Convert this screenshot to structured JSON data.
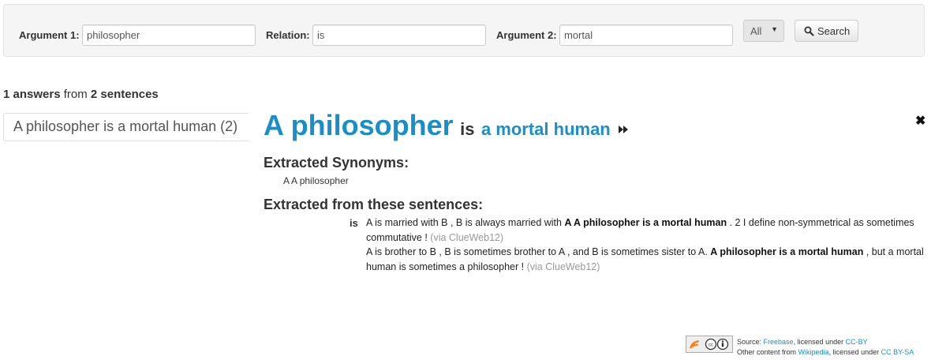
{
  "search": {
    "arg1_label": "Argument 1:",
    "arg1_value": "philosopher",
    "rel_label": "Relation:",
    "rel_value": "is",
    "arg2_label": "Argument 2:",
    "arg2_value": "mortal",
    "corpus_select": "All",
    "search_button": "Search"
  },
  "summary": {
    "answer_count": "1 answers",
    "from_word": "from",
    "sentence_count": "2 sentences"
  },
  "answers": [
    {
      "label": "A philosopher is a mortal human (2)"
    }
  ],
  "detail": {
    "arg1": "A philosopher",
    "rel": "is",
    "arg2": "a mortal human",
    "synonyms_heading": "Extracted Synonyms:",
    "synonyms": [
      "A A philosopher"
    ],
    "sources_heading": "Extracted from these sentences:",
    "relation_tag": "is",
    "sentences": [
      {
        "pre": "A is married with B , B is always married with ",
        "arg1": "A A philosopher",
        "mid1": " ",
        "rel": "is",
        "mid2": " ",
        "arg2": "a mortal human",
        "post": " . 2 I define non-symmetrical as sometimes commutative ! ",
        "via": "(via ClueWeb12)"
      },
      {
        "pre": "A is brother to B , B is sometimes brother to A , and B is sometimes sister to A. ",
        "arg1": "A philosopher",
        "mid1": " ",
        "rel": "is",
        "mid2": " ",
        "arg2": "a mortal human",
        "post": " , but a mortal human is sometimes a philosopher ! ",
        "via": "(via ClueWeb12)"
      }
    ]
  },
  "footer": {
    "line1_prefix": "Source: ",
    "line1_link": "Freebase",
    "line1_mid": ", licensed under ",
    "line1_license": "CC-BY",
    "line2_prefix": "Other content from ",
    "line2_link": "Wikipedia",
    "line2_mid": ", licensed under ",
    "line2_license": "CC BY-SA"
  },
  "colors": {
    "link": "#1a8ec9",
    "freebase_logo": "#f58220"
  }
}
